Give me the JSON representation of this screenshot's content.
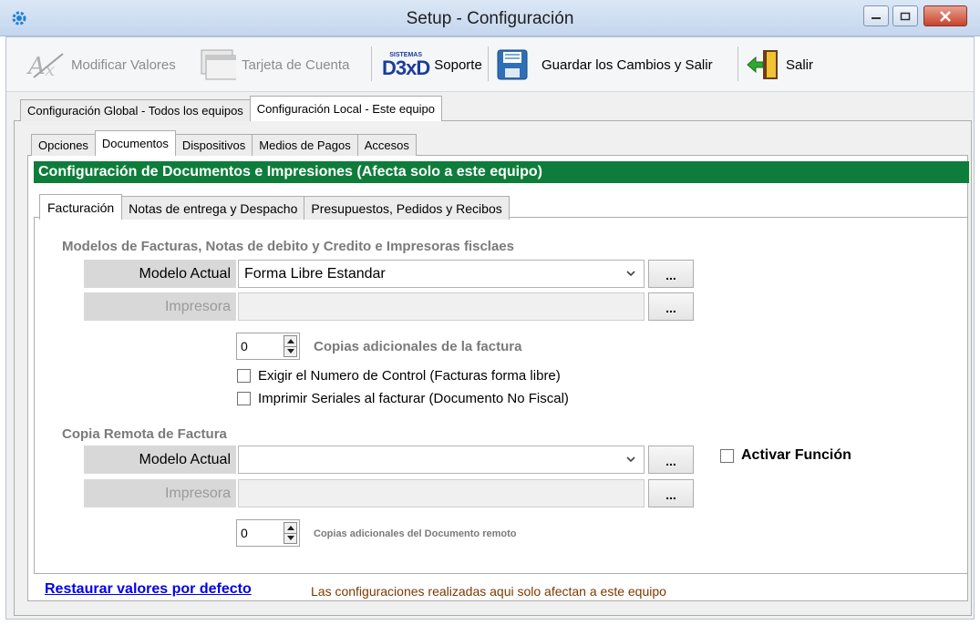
{
  "window": {
    "title": "Setup - Configuración"
  },
  "toolbar": {
    "modify_label": "Modificar Valores",
    "card_label": "Tarjeta de Cuenta",
    "support_logo_small": "SISTEMAS",
    "support_logo_big": "D3xD",
    "support_label": "Soporte",
    "save_exit_label": "Guardar los Cambios  y Salir",
    "exit_label": "Salir"
  },
  "scope_tabs": [
    "Configuración Global - Todos los equipos",
    "Configuración Local - Este equipo"
  ],
  "section_tabs": [
    "Opciones",
    "Documentos",
    "Dispositivos",
    "Medios de Pagos",
    "Accesos"
  ],
  "header": "Configuración de Documentos e Impresiones (Afecta solo a este equipo)",
  "doc_tabs": [
    "Facturación",
    "Notas de entrega y Despacho",
    "Presupuestos, Pedidos y Recibos"
  ],
  "invoice": {
    "section_title": "Modelos de Facturas, Notas de debito y Credito e Impresoras fisclaes",
    "model_label": "Modelo Actual",
    "model_value": "Forma Libre Estandar",
    "printer_label": "Impresora",
    "printer_value": "",
    "dots": "...",
    "copies_value": "0",
    "copies_label": "Copias adicionales de la factura",
    "check_control": "Exigir el Numero de Control (Facturas forma libre)",
    "check_serials": "Imprimir  Seriales al facturar (Documento No Fiscal)"
  },
  "remote": {
    "section_title": "Copia Remota de Factura",
    "model_label": "Modelo Actual",
    "model_value": "",
    "printer_label": "Impresora",
    "printer_value": "",
    "dots": "...",
    "activate_label": "Activar Función",
    "copies_value": "0",
    "copies_label": "Copias adicionales del Documento remoto"
  },
  "footer": {
    "restore_link": "Restaurar valores por defecto",
    "note": "Las configuraciones realizadas aqui solo afectan a este equipo"
  },
  "colors": {
    "header_green": "#0e7d3b",
    "link_blue": "#0000ee",
    "note_brown": "#7a3a00"
  }
}
